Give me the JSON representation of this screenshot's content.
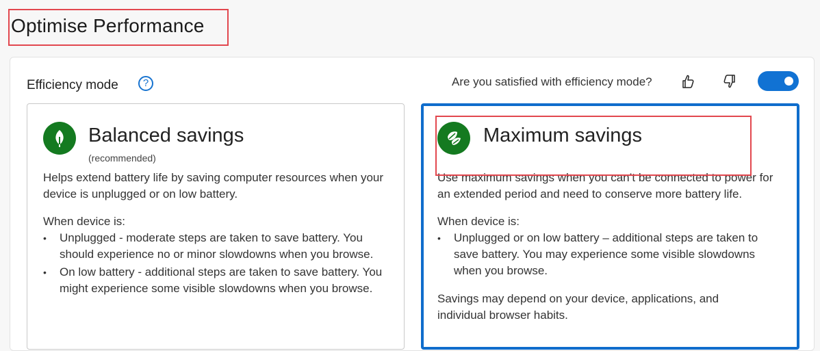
{
  "page": {
    "title": "Optimise Performance"
  },
  "efficiency": {
    "label": "Efficiency mode",
    "help_icon": "question-circle-icon",
    "feedback_question": "Are you satisfied with efficiency mode?",
    "thumb_up_icon": "thumbs-up-icon",
    "thumb_down_icon": "thumbs-down-icon",
    "toggle_on": true
  },
  "cards": {
    "balanced": {
      "title": "Balanced savings",
      "subtitle": "(recommended)",
      "description": "Helps extend battery life by saving computer resources when your device is unplugged or on low battery.",
      "when_label": "When device is:",
      "bullets": [
        "Unplugged - moderate steps are taken to save battery. You should experience no or minor slowdowns when you browse.",
        "On low battery - additional steps are taken to save battery. You might experience some visible slowdowns when you browse."
      ],
      "icon": "leaf-icon"
    },
    "maximum": {
      "title": "Maximum savings",
      "description": "Use maximum savings when you can’t be connected to power for an extended period and need to conserve more battery life.",
      "when_label": "When device is:",
      "bullets": [
        "Unplugged or on low battery – additional steps are taken to save battery. You may experience some visible slowdowns when you browse."
      ],
      "footer": "Savings may depend on your device, applications, and individual browser habits.",
      "icon": "leaves-icon"
    }
  },
  "colors": {
    "accent": "#0f6dcc",
    "icon_green": "#147a20",
    "annotation_red": "#e2474e"
  }
}
